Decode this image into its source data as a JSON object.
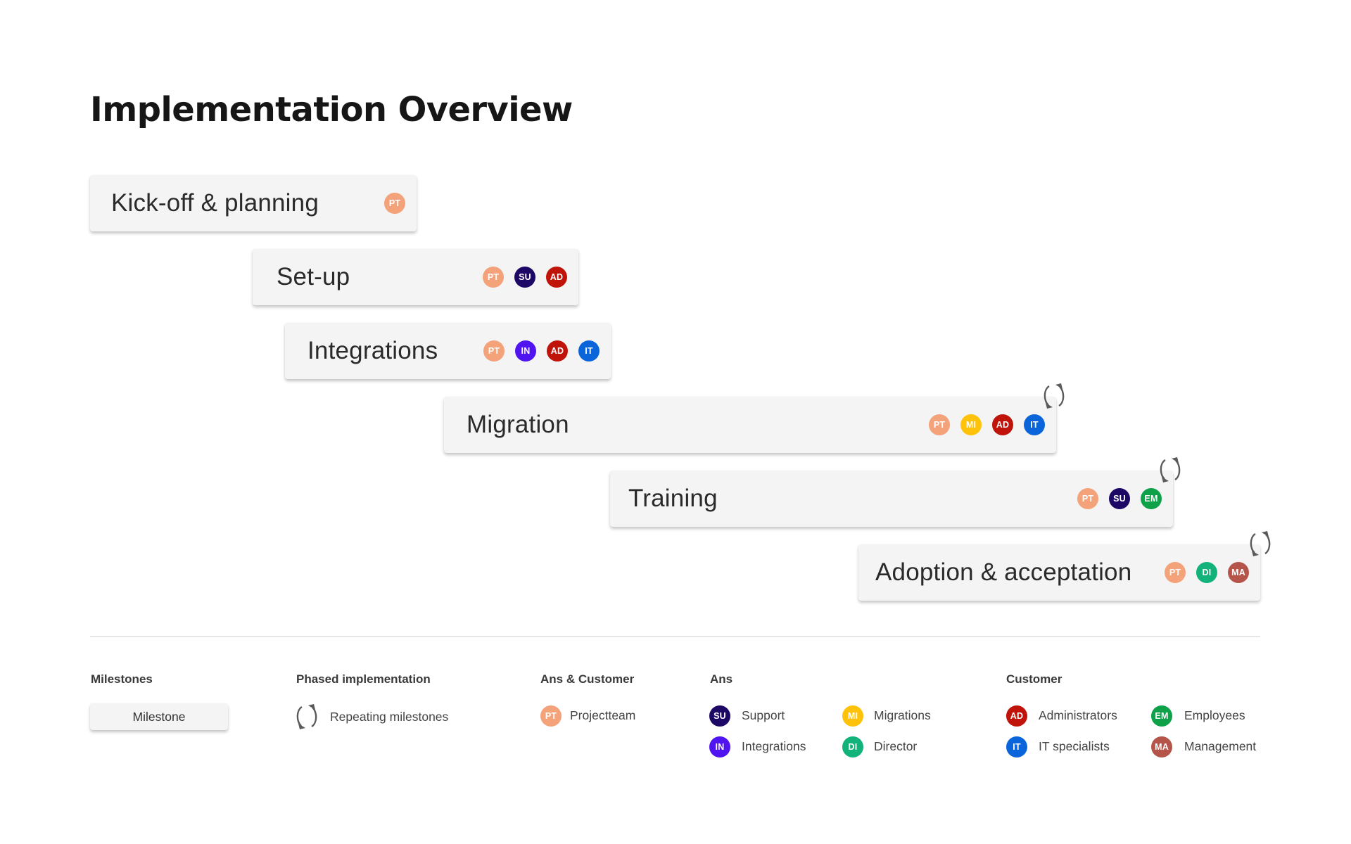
{
  "title": "Implementation Overview",
  "roles": {
    "PT": {
      "code": "PT",
      "name": "Projectteam",
      "color": "#F4A27A"
    },
    "SU": {
      "code": "SU",
      "name": "Support",
      "color": "#1D0866"
    },
    "IN": {
      "code": "IN",
      "name": "Integrations",
      "color": "#5014F0"
    },
    "MI": {
      "code": "MI",
      "name": "Migrations",
      "color": "#FFC20A"
    },
    "DI": {
      "code": "DI",
      "name": "Director",
      "color": "#12B37A"
    },
    "AD": {
      "code": "AD",
      "name": "Administrators",
      "color": "#C0140A"
    },
    "IT": {
      "code": "IT",
      "name": "IT specialists",
      "color": "#0A65DA"
    },
    "EM": {
      "code": "EM",
      "name": "Employees",
      "color": "#0EA14A"
    },
    "MA": {
      "code": "MA",
      "name": "Management",
      "color": "#B5554A"
    }
  },
  "phases": [
    {
      "label": "Kick-off & planning",
      "roles": [
        "PT"
      ],
      "repeating": false
    },
    {
      "label": "Set-up",
      "roles": [
        "PT",
        "SU",
        "AD"
      ],
      "repeating": false
    },
    {
      "label": "Integrations",
      "roles": [
        "PT",
        "IN",
        "AD",
        "IT"
      ],
      "repeating": false
    },
    {
      "label": "Migration",
      "roles": [
        "PT",
        "MI",
        "AD",
        "IT"
      ],
      "repeating": true
    },
    {
      "label": "Training",
      "roles": [
        "PT",
        "SU",
        "EM"
      ],
      "repeating": true
    },
    {
      "label": "Adoption & acceptation",
      "roles": [
        "PT",
        "DI",
        "MA"
      ],
      "repeating": true
    }
  ],
  "legend": {
    "milestones": {
      "heading": "Milestones",
      "sample_label": "Milestone"
    },
    "phased": {
      "heading": "Phased implementation",
      "repeat_label": "Repeating milestones",
      "icon": "repeat-icon"
    },
    "ans_customer": {
      "heading": "Ans & Customer",
      "items": [
        "PT"
      ]
    },
    "ans": {
      "heading": "Ans",
      "items": [
        "SU",
        "IN",
        "MI",
        "DI"
      ]
    },
    "customer": {
      "heading": "Customer",
      "items": [
        "AD",
        "IT",
        "EM",
        "MA"
      ]
    }
  }
}
